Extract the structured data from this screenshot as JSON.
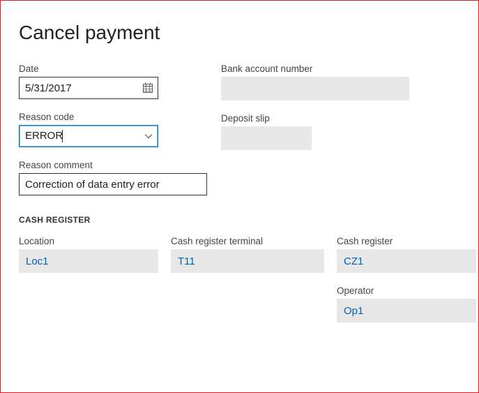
{
  "title": "Cancel payment",
  "fields": {
    "date": {
      "label": "Date",
      "value": "5/31/2017"
    },
    "bank_account": {
      "label": "Bank account number",
      "value": ""
    },
    "reason_code": {
      "label": "Reason code",
      "value": "ERROR"
    },
    "deposit_slip": {
      "label": "Deposit slip",
      "value": ""
    },
    "reason_comment": {
      "label": "Reason comment",
      "value": "Correction of data entry error"
    }
  },
  "section": "CASH REGISTER",
  "cash": {
    "location": {
      "label": "Location",
      "value": "Loc1"
    },
    "terminal": {
      "label": "Cash register terminal",
      "value": "T11"
    },
    "register": {
      "label": "Cash register",
      "value": "CZ1"
    },
    "operator": {
      "label": "Operator",
      "value": "Op1"
    }
  },
  "icons": {
    "calendar": "calendar-icon",
    "chevron_down": "chevron-down-icon"
  },
  "colors": {
    "accent": "#0078d7",
    "link": "#0062b1",
    "readonly_bg": "#e7e7e7",
    "border_error": "#e31b1b"
  }
}
